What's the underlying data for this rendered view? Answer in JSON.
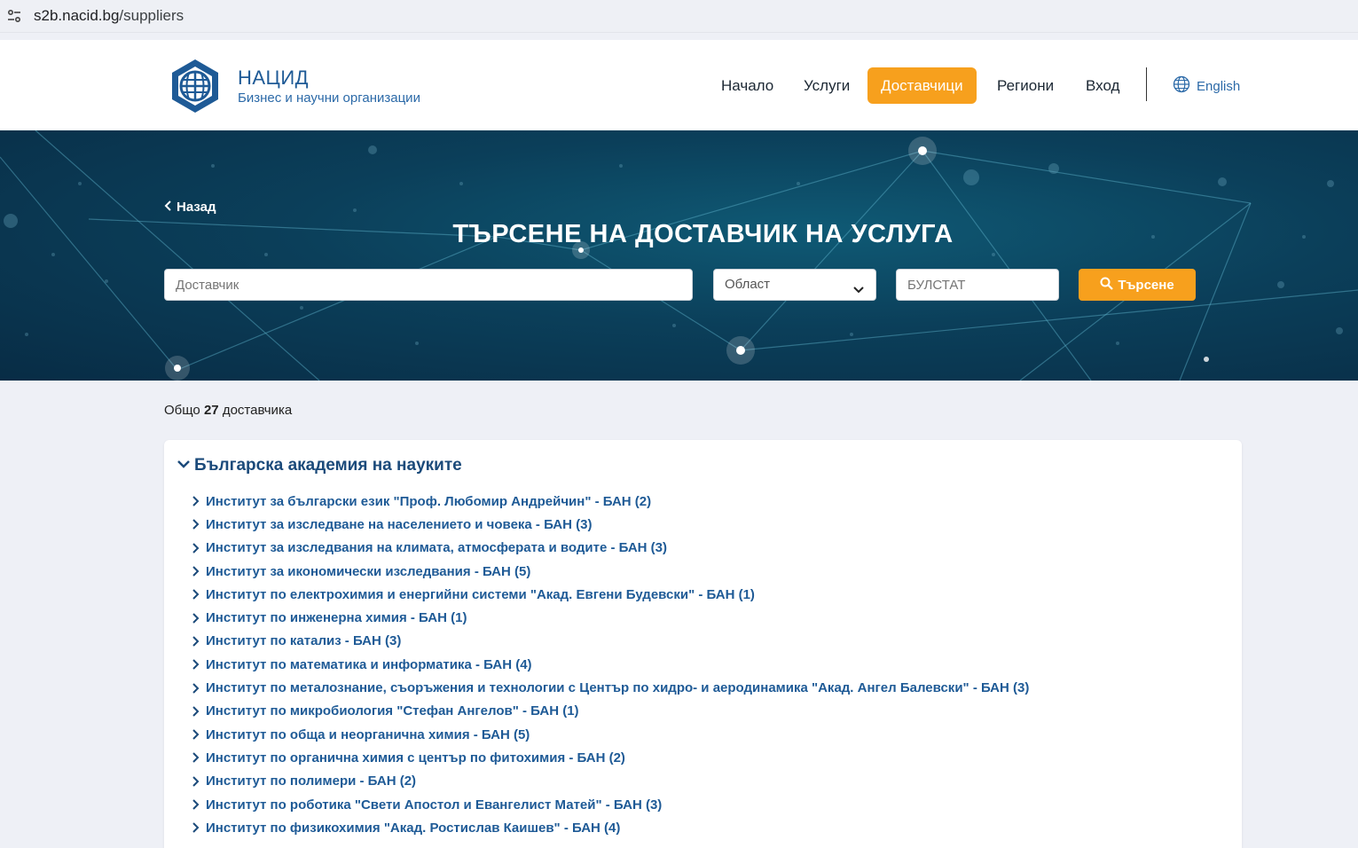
{
  "browser": {
    "url_host": "s2b.nacid.bg",
    "url_path": "/suppliers"
  },
  "header": {
    "brand_title": "НАЦИД",
    "brand_subtitle": "Бизнес и научни организации",
    "nav": [
      {
        "label": "Начало",
        "active": false
      },
      {
        "label": "Услуги",
        "active": false
      },
      {
        "label": "Доставчици",
        "active": true
      },
      {
        "label": "Региони",
        "active": false
      },
      {
        "label": "Вход",
        "active": false
      }
    ],
    "language": "English"
  },
  "hero": {
    "back_label": "Назад",
    "title": "ТЪРСЕНЕ НА ДОСТАВЧИК НА УСЛУГА",
    "supplier_placeholder": "Доставчик",
    "region_placeholder": "Област",
    "bulstat_placeholder": "БУЛСТАТ",
    "search_label": "Търсене"
  },
  "results": {
    "total_prefix": "Общо",
    "total_count": "27",
    "total_suffix": "доставчика",
    "group": {
      "title": "Българска академия на науките",
      "items": [
        "Институт за български език \"Проф. Любомир Андрейчин\" - БАН (2)",
        "Институт за изследване на населението и човека - БАН (3)",
        "Институт за изследвания на климата, атмосферата и водите - БАН (3)",
        "Институт за икономически изследвания - БАН (5)",
        "Институт по електрохимия и енергийни системи \"Акад. Евгени Будевски\" - БАН (1)",
        "Институт по инженерна химия - БАН (1)",
        "Институт по катализ - БАН (3)",
        "Институт по математика и информатика - БАН (4)",
        "Институт по металознание, съоръжения и технологии с Център по хидро- и аеродинамика \"Акад. Ангел Балевски\" - БАН (3)",
        "Институт по микробиология \"Стефан Ангелов\" - БАН (1)",
        "Институт по обща и неорганична химия - БАН (5)",
        "Институт по органична химия с център по фитохимия - БАН (2)",
        "Институт по полимери - БАН (2)",
        "Институт по роботика \"Свети Апостол и Евангелист Матей\" - БАН (3)",
        "Институт по физикохимия \"Акад. Ростислав Каишев\" - БАН (4)"
      ]
    }
  },
  "colors": {
    "accent": "#f7a01d",
    "brand_blue": "#1e5a96",
    "hero_dark": "#0b3f5a"
  }
}
